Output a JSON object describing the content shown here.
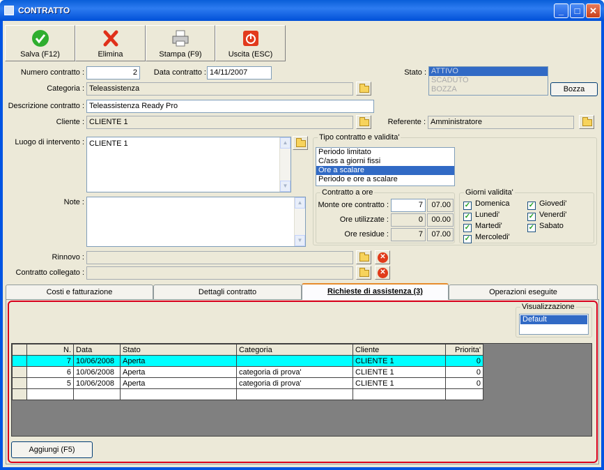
{
  "window": {
    "title": "CONTRATTO"
  },
  "toolbar": {
    "save": "Salva (F12)",
    "delete": "Elimina",
    "print": "Stampa (F9)",
    "exit": "Uscita (ESC)"
  },
  "form": {
    "numero_label": "Numero contratto :",
    "numero_value": "2",
    "data_label": "Data contratto :",
    "data_value": "14/11/2007",
    "stato_label": "Stato :",
    "stato_options": [
      "ATTIVO",
      "SCADUTO",
      "BOZZA"
    ],
    "bozza_button": "Bozza",
    "categoria_label": "Categoria :",
    "categoria_value": "Teleassistenza",
    "descrizione_label": "Descrizione contratto :",
    "descrizione_value": "Teleassistenza Ready Pro",
    "cliente_label": "Cliente :",
    "cliente_value": "CLIENTE 1",
    "referente_label": "Referente :",
    "referente_value": "Amministratore",
    "luogo_label": "Luogo di intervento :",
    "luogo_value": "CLIENTE 1",
    "note_label": "Note :",
    "note_value": "",
    "rinnovo_label": "Rinnovo :",
    "rinnovo_value": "",
    "collegato_label": "Contratto collegato :",
    "collegato_value": ""
  },
  "tipo": {
    "title": "Tipo contratto e validita'",
    "options": [
      "Periodo limitato",
      "C/ass a giorni fissi",
      "Ore a scalare",
      "Periodo e ore a scalare"
    ],
    "selected": "Ore a scalare"
  },
  "ore": {
    "title": "Contratto a ore",
    "monte_label": "Monte ore contratto :",
    "monte_value": "7",
    "monte_time": "07.00",
    "utilizzate_label": "Ore utilizzate :",
    "utilizzate_value": "0",
    "utilizzate_time": "00.00",
    "residue_label": "Ore residue :",
    "residue_value": "7",
    "residue_time": "07.00"
  },
  "giorni": {
    "title": "Giorni validita'",
    "days": [
      "Domenica",
      "Lunedi'",
      "Martedi'",
      "Mercoledi'",
      "Giovedi'",
      "Venerdi'",
      "Sabato"
    ],
    "checked": [
      true,
      true,
      true,
      true,
      true,
      true,
      true
    ]
  },
  "tabs": [
    "Costi e fatturazione",
    "Dettagli contratto",
    "Richieste di assistenza (3)",
    "Operazioni eseguite"
  ],
  "active_tab": "Richieste di assistenza (3)",
  "visualizzazione": {
    "title": "Visualizzazione",
    "options": [
      "Default"
    ],
    "selected": "Default"
  },
  "table": {
    "columns": [
      "N.",
      "Data",
      "Stato",
      "Categoria",
      "Cliente",
      "Priorita'"
    ],
    "rows": [
      [
        "7",
        "10/06/2008",
        "Aperta",
        "",
        "CLIENTE 1",
        "0"
      ],
      [
        "6",
        "10/06/2008",
        "Aperta",
        "categoria di prova'",
        "CLIENTE 1",
        "0"
      ],
      [
        "5",
        "10/06/2008",
        "Aperta",
        "categoria di prova'",
        "CLIENTE 1",
        "0"
      ]
    ],
    "highlight_row": 0
  },
  "add_button": "Aggiungi (F5)",
  "colors": {
    "titlebar": "#0054e3",
    "selection": "#316ac5",
    "row_highlight": "#00ffff",
    "frame": "#d8001c"
  }
}
